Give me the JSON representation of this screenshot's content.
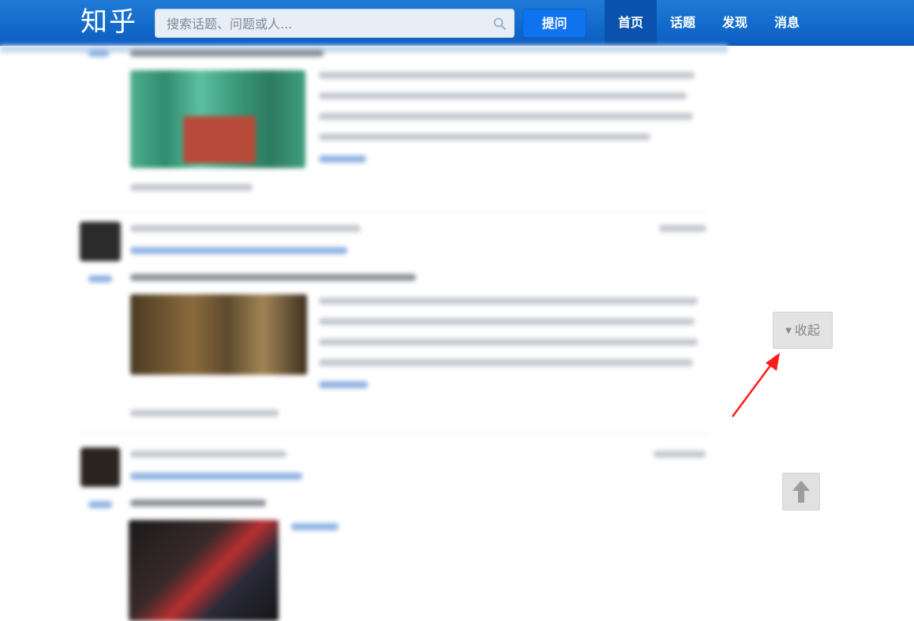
{
  "header": {
    "logo": "知乎",
    "search_placeholder": "搜索话题、问题或人...",
    "ask_label": "提问",
    "nav": [
      "首页",
      "话题",
      "发现",
      "消息"
    ]
  },
  "side": {
    "collapse_label": "收起"
  },
  "colors": {
    "header": "#0b5ec2",
    "annotation_arrow": "#ff1a1a"
  }
}
